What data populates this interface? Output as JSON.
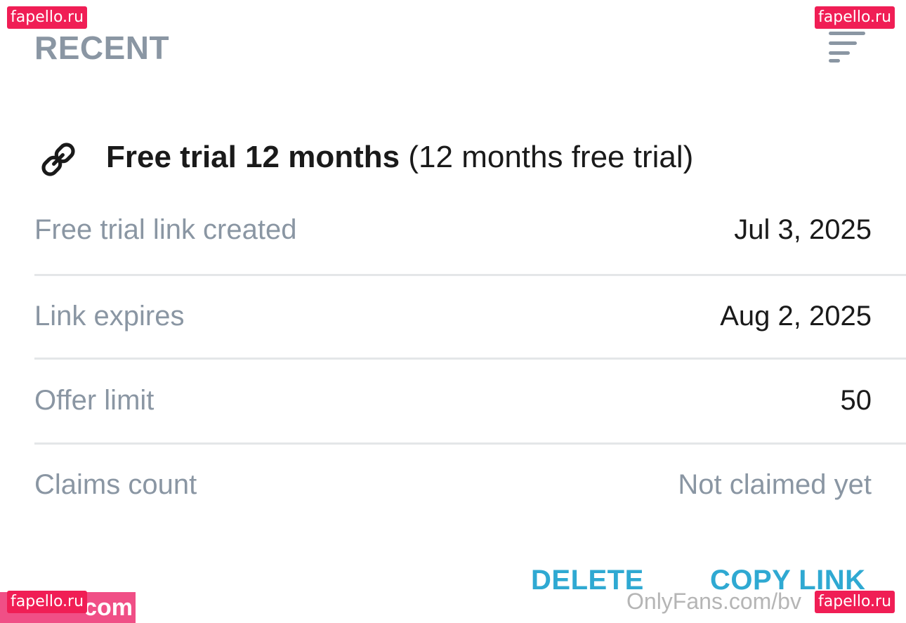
{
  "header": {
    "title": "RECENT",
    "sort_icon": "sort-lines-icon"
  },
  "offer": {
    "icon": "link-icon",
    "name": "Free trial 12 months",
    "description": "(12 months free trial)"
  },
  "details": {
    "rows": [
      {
        "label": "Free trial link created",
        "value": "Jul 3, 2025"
      },
      {
        "label": "Link expires",
        "value": "Aug 2, 2025"
      },
      {
        "label": "Offer limit",
        "value": "50"
      },
      {
        "label": "Claims count",
        "value": "Not claimed yet"
      }
    ]
  },
  "actions": {
    "delete_label": "DELETE",
    "copy_label": "COPY LINK"
  },
  "watermarks": {
    "site_label": "fapello.ru",
    "corner_text": "com",
    "footer_text": "OnlyFans.com/bv"
  },
  "colors": {
    "accent": "#2fa9d2",
    "muted_text": "#8a96a3",
    "primary_text": "#1a1a1a",
    "divider": "#e4e6e8",
    "watermark": "#f01e55"
  }
}
